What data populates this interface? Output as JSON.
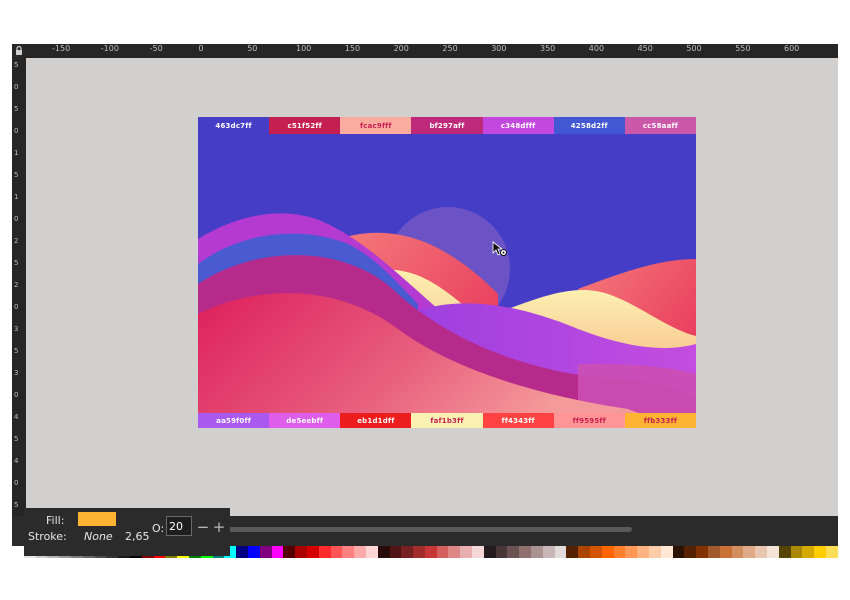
{
  "ruler": {
    "top_labels": [
      "-150",
      "-100",
      "-50",
      "0",
      "50",
      "100",
      "150",
      "200",
      "250",
      "300",
      "350",
      "400",
      "450",
      "500",
      "550",
      "600"
    ],
    "left_labels": [
      "5",
      "0",
      "5",
      "0",
      "1",
      "5",
      "1",
      "0",
      "2",
      "5",
      "2",
      "0",
      "3",
      "5",
      "3",
      "0",
      "4",
      "5",
      "4",
      "0",
      "5"
    ]
  },
  "artboard": {
    "top_swatches": [
      {
        "label": "463dc7ff",
        "bg": "#463dc7",
        "fg": "#ffffff"
      },
      {
        "label": "c51f52ff",
        "bg": "#c51f52",
        "fg": "#ffffff"
      },
      {
        "label": "fcac9fff",
        "bg": "#fcac9f",
        "fg": "#c51f52"
      },
      {
        "label": "bf297aff",
        "bg": "#bf297a",
        "fg": "#ffffff"
      },
      {
        "label": "c348dfff",
        "bg": "#c348df",
        "fg": "#ffffff"
      },
      {
        "label": "4258d2ff",
        "bg": "#4258d2",
        "fg": "#ffffff"
      },
      {
        "label": "cc58aaff",
        "bg": "#cc58aa",
        "fg": "#ffffff"
      }
    ],
    "bottom_swatches": [
      {
        "label": "aa59f0ff",
        "bg": "#aa59f0",
        "fg": "#ffffff"
      },
      {
        "label": "de5eebff",
        "bg": "#de5eeb",
        "fg": "#ffffff"
      },
      {
        "label": "eb1d1dff",
        "bg": "#eb1d1d",
        "fg": "#ffffff"
      },
      {
        "label": "faf1b3ff",
        "bg": "#faf1b3",
        "fg": "#c51f52"
      },
      {
        "label": "ff4343ff",
        "bg": "#ff4343",
        "fg": "#ffffff"
      },
      {
        "label": "ff9595ff",
        "bg": "#ff9595",
        "fg": "#c51f52"
      },
      {
        "label": "ffb333ff",
        "bg": "#ffb333",
        "fg": "#c51f52"
      }
    ]
  },
  "fill_stroke": {
    "fill_label": "Fill:",
    "fill_color": "#ffb333",
    "stroke_label": "Stroke:",
    "stroke_value": "None",
    "stroke_width": "2,65",
    "opacity_label": "O:",
    "opacity_value": "20",
    "minus": "−",
    "plus": "+"
  },
  "palette": [
    "#ffffff",
    "#e6e6e6",
    "#cccccc",
    "#b3b3b3",
    "#999999",
    "#808080",
    "#666666",
    "#4d4d4d",
    "#333333",
    "#1a1a1a",
    "#000000",
    "#800000",
    "#ff0000",
    "#808000",
    "#ffff00",
    "#008000",
    "#00ff00",
    "#008080",
    "#00ffff",
    "#000080",
    "#0000ff",
    "#800080",
    "#ff00ff",
    "#550000",
    "#aa0000",
    "#d40000",
    "#ff2a2a",
    "#ff5555",
    "#ff8080",
    "#ffaaaa",
    "#ffd5d5",
    "#280b0b",
    "#501616",
    "#782121",
    "#a02c2c",
    "#c83737",
    "#d35f5f",
    "#de8787",
    "#e9afaf",
    "#f4d7d7",
    "#241c1c",
    "#483737",
    "#6c5353",
    "#916f6f",
    "#ac9393",
    "#c8b7b7",
    "#e3dbdb",
    "#552200",
    "#aa4400",
    "#d45500",
    "#ff6600",
    "#ff7f2a",
    "#ff9955",
    "#ffb380",
    "#ffccaa",
    "#ffe6d5",
    "#2b1100",
    "#552200",
    "#803300",
    "#a05a2c",
    "#c87137",
    "#d38d5f",
    "#deaa87",
    "#e9c6af",
    "#f4e3d7",
    "#554400",
    "#aa8800",
    "#d4aa00",
    "#ffcc00",
    "#ffdd55"
  ]
}
